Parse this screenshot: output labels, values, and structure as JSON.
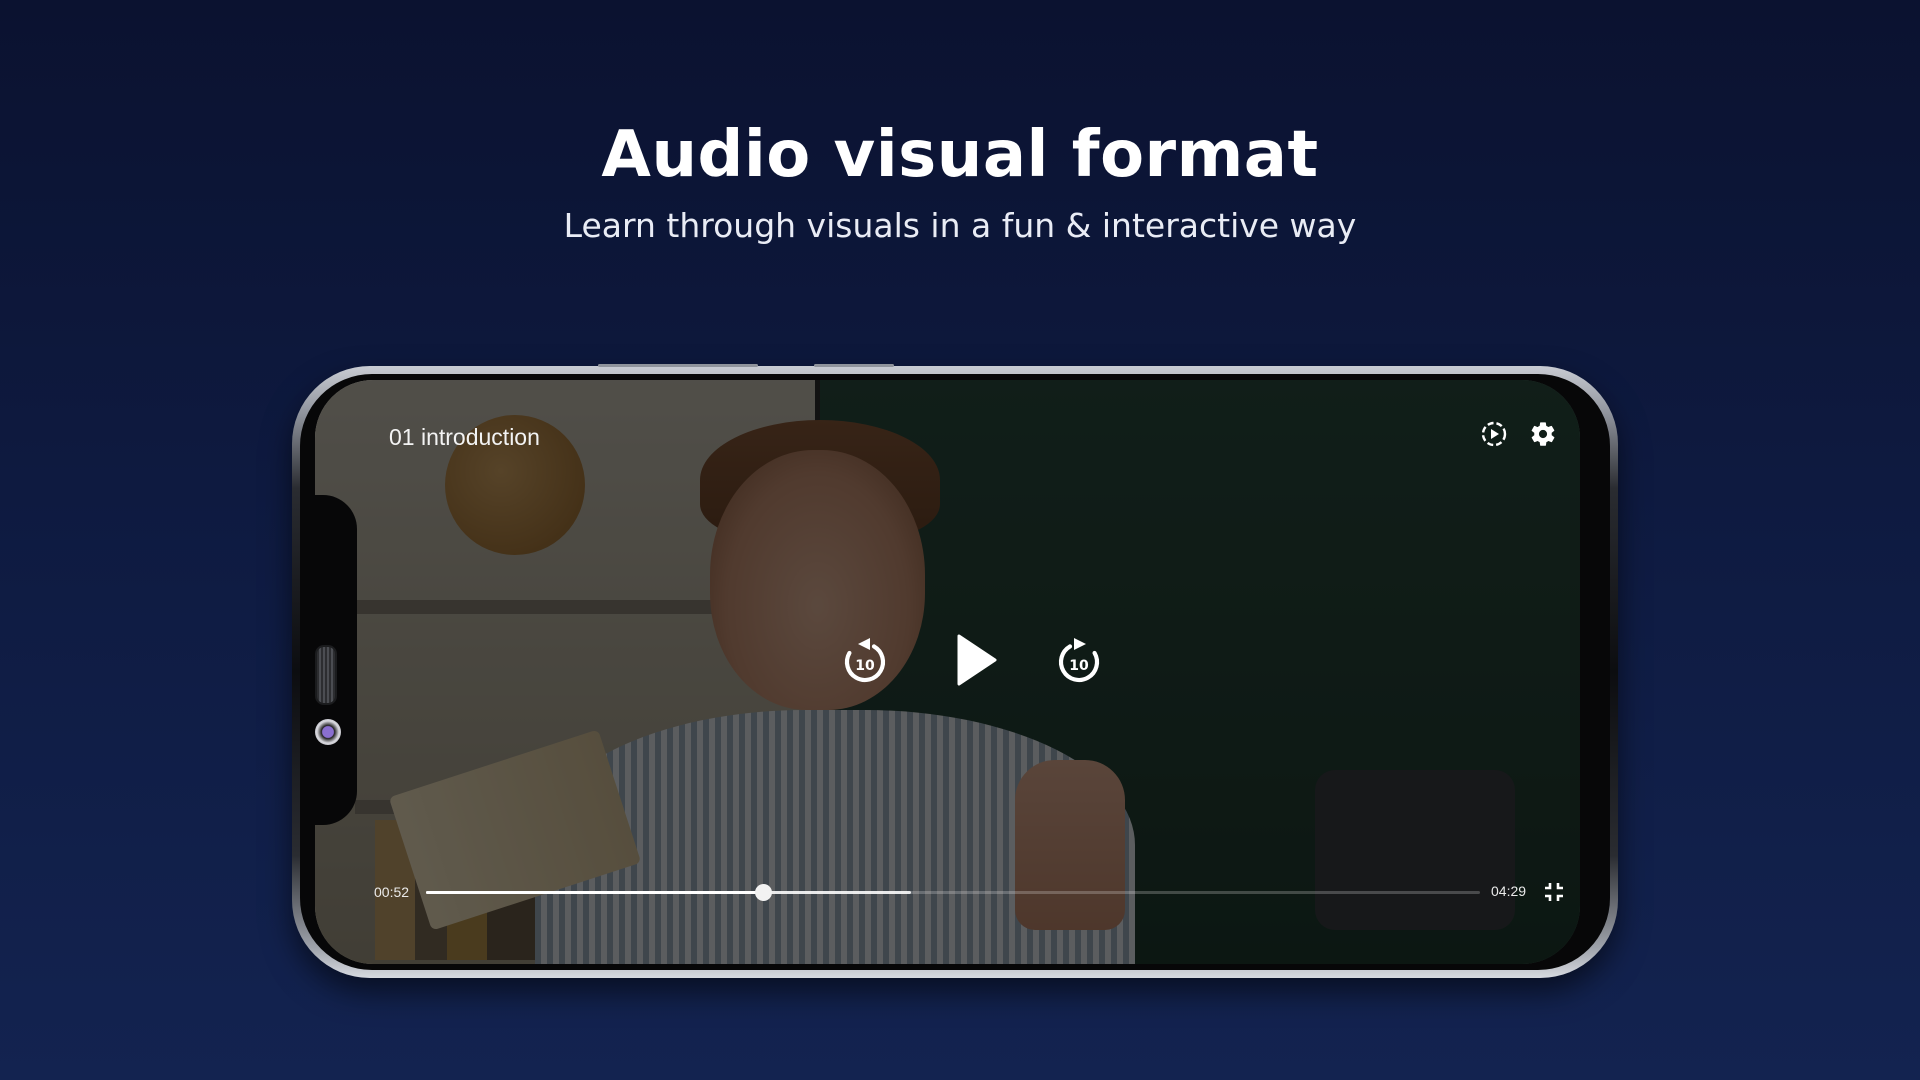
{
  "hero": {
    "title": "Audio visual format",
    "subtitle": "Learn through visuals in a fun & interactive way"
  },
  "player": {
    "video_title": "01 introduction",
    "current_time": "00:52",
    "total_time": "04:29",
    "progress_fraction": 0.32,
    "buffered_fraction": 0.46,
    "rewind_seconds": "10",
    "forward_seconds": "10",
    "icons": {
      "autoplay": "autoplay-icon",
      "settings": "gear-icon",
      "rewind": "rewind-10-icon",
      "play": "play-icon",
      "forward": "forward-10-icon",
      "exit_fullscreen": "exit-fullscreen-icon"
    }
  }
}
